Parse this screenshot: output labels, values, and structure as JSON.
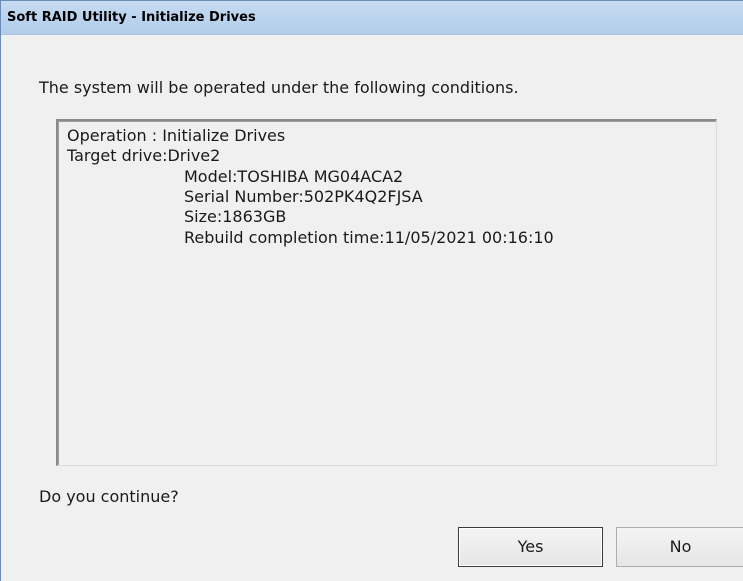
{
  "window": {
    "title": "Soft RAID Utility - Initialize Drives"
  },
  "dialog": {
    "message": "The system will be operated under the following conditions.",
    "details": {
      "operation": "Operation : Initialize Drives",
      "target_drive": "Target drive:Drive2",
      "model": "Model:TOSHIBA MG04ACA2",
      "serial_number": "Serial Number:502PK4Q2FJSA",
      "size": "Size:1863GB",
      "rebuild_completion": "Rebuild completion time:11/05/2021 00:16:10"
    },
    "question": "Do you continue?",
    "buttons": {
      "yes_label": "Yes",
      "no_label": "No"
    }
  }
}
